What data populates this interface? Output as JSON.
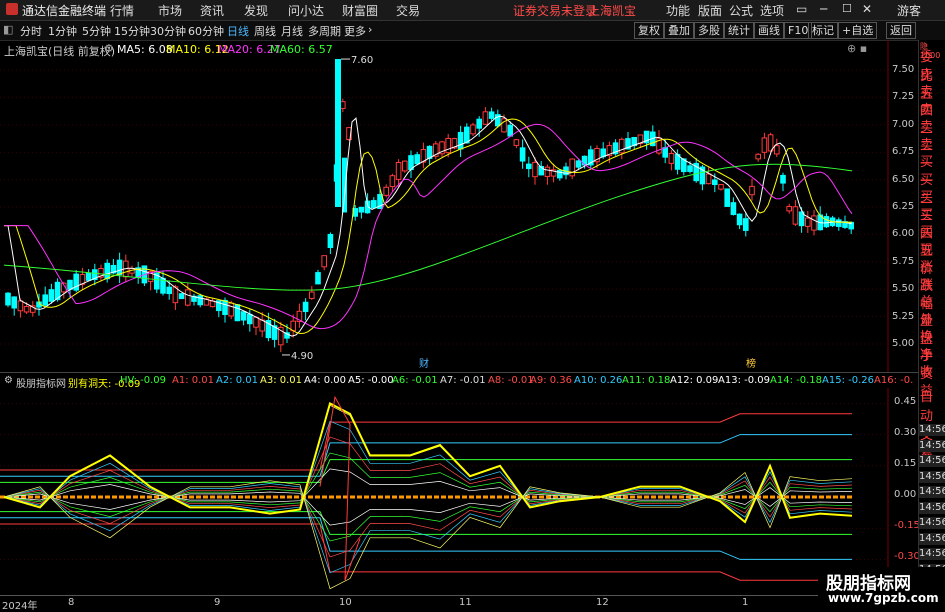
{
  "app": {
    "title": "通达信金融终端"
  },
  "menu": {
    "items": [
      "行情",
      "市场",
      "资讯",
      "发现",
      "问小达",
      "财富圈",
      "交易"
    ],
    "broker_status": "证券交易未登录",
    "stock_name": "上海凯宝",
    "right_items": [
      "功能",
      "版面",
      "公式",
      "选项"
    ],
    "guest": "游客"
  },
  "toolbar": {
    "periods": [
      "分时",
      "1分钟",
      "5分钟",
      "15分钟",
      "30分钟",
      "60分钟",
      "日线",
      "周线",
      "月线",
      "多周期",
      "更多"
    ],
    "active_period": "日线",
    "buttons": [
      "复权",
      "叠加",
      "多股",
      "统计",
      "画线",
      "F10",
      "标记",
      "+自选",
      "返回"
    ]
  },
  "main": {
    "title": "上海凯宝(日线 前复权)",
    "ma": [
      {
        "label": "MA5: 6.08",
        "color": "#ffffff"
      },
      {
        "label": "MA10: 6.12",
        "color": "#ffff00"
      },
      {
        "label": "MA20: 6.27",
        "color": "#ff33ff"
      },
      {
        "label": "MA60: 6.57",
        "color": "#33ff33"
      }
    ],
    "high_label": "7.60",
    "low_label": "4.90",
    "markers": [
      "财",
      "榜"
    ],
    "axis": [
      "7.50",
      "7.25",
      "7.00",
      "6.75",
      "6.50",
      "6.25",
      "6.00",
      "5.75",
      "5.50",
      "5.25",
      "5.00"
    ],
    "colors": {
      "up": "#ff3b3b",
      "down": "#00ffff"
    }
  },
  "indicator": {
    "title": "股朋指标网",
    "params": [
      {
        "label": "别有洞天: -0.09",
        "color": "#ffff00"
      },
      {
        "label": "HV: -0.09",
        "color": "#33ff33"
      },
      {
        "label": "A1: 0.01",
        "color": "#ff4a4a"
      },
      {
        "label": "A2: 0.01",
        "color": "#33ccff"
      },
      {
        "label": "A3: 0.01",
        "color": "#ffff66"
      },
      {
        "label": "A4: 0.00",
        "color": "#ffffff"
      },
      {
        "label": "A5: -0.00",
        "color": "#ffffff"
      },
      {
        "label": "A6: -0.01",
        "color": "#33ff33"
      },
      {
        "label": "A7: -0.01",
        "color": "#dddddd"
      },
      {
        "label": "A8: -0.01",
        "color": "#ff4a4a"
      },
      {
        "label": "A9: 0.36",
        "color": "#ff4a4a"
      },
      {
        "label": "A10: 0.26",
        "color": "#33ccff"
      },
      {
        "label": "A11: 0.18",
        "color": "#33ff33"
      },
      {
        "label": "A12: 0.09",
        "color": "#ffffff"
      },
      {
        "label": "A13: -0.09",
        "color": "#ffffff"
      },
      {
        "label": "A14: -0.18",
        "color": "#33ff33"
      },
      {
        "label": "A15: -0.26",
        "color": "#33ccff"
      },
      {
        "label": "A16: -0.",
        "color": "#ff4a4a"
      }
    ],
    "axis": [
      "0.45",
      "0.30",
      "0.15",
      "0.00",
      "-0.15",
      "-0.30"
    ]
  },
  "sidebar": {
    "items": [
      {
        "label": "委比",
        "color": "red"
      },
      {
        "label": "卖五",
        "color": "red"
      },
      {
        "label": "卖四",
        "color": "red"
      },
      {
        "label": "卖三",
        "color": "red"
      },
      {
        "label": "卖二",
        "color": "red"
      },
      {
        "label": "卖一",
        "color": "red"
      },
      {
        "label": "买一",
        "color": "red"
      },
      {
        "label": "买二",
        "color": "red"
      },
      {
        "label": "买三",
        "color": "red"
      },
      {
        "label": "买四",
        "color": "red"
      },
      {
        "label": "买五",
        "color": "red"
      },
      {
        "label": "现价",
        "color": "red"
      },
      {
        "label": "涨跌",
        "color": "red"
      },
      {
        "label": "涨幅",
        "color": "red"
      },
      {
        "label": "总量",
        "color": "red"
      },
      {
        "label": "外盘",
        "color": "red"
      },
      {
        "label": "换手",
        "color": "red"
      },
      {
        "label": "净资",
        "color": "red"
      },
      {
        "label": "收益",
        "color": "red"
      }
    ],
    "auto_trade": "自动交易",
    "times": [
      "14:56",
      "14:56",
      "14:56",
      "14:56",
      "14:56",
      "14:56",
      "14:56",
      "14:56",
      "14:56",
      "14:56"
    ]
  },
  "time_axis": [
    "2024年",
    "8",
    "9",
    "10",
    "11",
    "12",
    "1"
  ],
  "watermark": {
    "title": "股朋指标网",
    "url": "www.7gpzb.com"
  }
}
